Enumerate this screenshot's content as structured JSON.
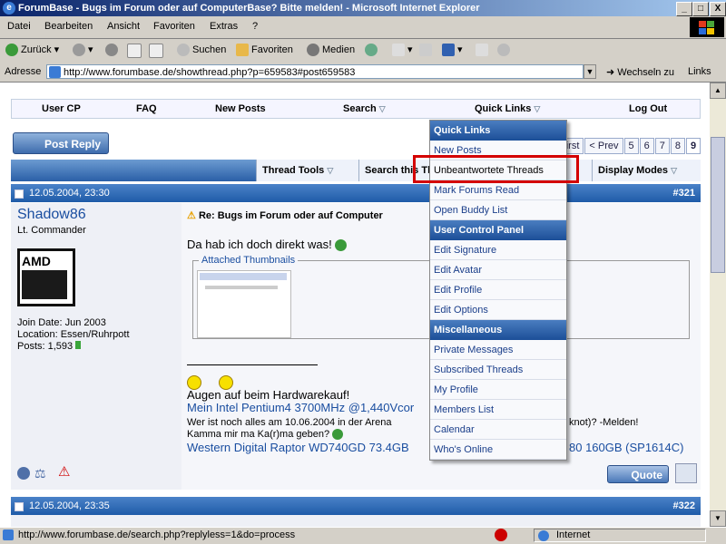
{
  "window": {
    "title": "ForumBase - Bugs im Forum oder auf ComputerBase? Bitte melden! - Microsoft Internet Explorer",
    "min": "_",
    "max": "□",
    "close": "X"
  },
  "menubar": [
    "Datei",
    "Bearbeiten",
    "Ansicht",
    "Favoriten",
    "Extras",
    "?"
  ],
  "toolbar": {
    "back": "Zurück",
    "search": "Suchen",
    "favorites": "Favoriten",
    "media": "Medien"
  },
  "address": {
    "label": "Adresse",
    "url": "http://www.forumbase.de/showthread.php?p=659583#post659583",
    "go": "Wechseln zu",
    "links": "Links"
  },
  "forum_nav": {
    "user_cp": "User CP",
    "faq": "FAQ",
    "new_posts": "New Posts",
    "search": "Search",
    "quick_links": "Quick Links",
    "log_out": "Log Out"
  },
  "post_reply": "Post Reply",
  "pager": [
    "First",
    "< Prev",
    "5",
    "6",
    "7",
    "8",
    "9"
  ],
  "thread_bar": {
    "thread_tools": "Thread Tools",
    "search_thread": "Search this Thread",
    "display_modes": "Display Modes"
  },
  "post1": {
    "date": "12.05.2004, 23:30",
    "number": "#321",
    "username": "Shadow86",
    "user_title": "Lt. Commander",
    "avatar_text": "AMD",
    "join_date": "Join Date: Jun 2003",
    "location": "Location: Essen/Ruhrpott",
    "posts": "Posts: 1,593",
    "subject": "Re: Bugs im Forum oder auf Computer",
    "message": "Da hab ich doch direkt was!",
    "attached": "Attached Thumbnails",
    "sig_line1": "Augen auf beim Hardwarekauf!",
    "sig_line2": "Mein Intel Pentium4 3700MHz @1,440Vcor",
    "sig_line3": "Wer ist noch alles am 10.06.2004 in der Arena",
    "sig_line3b": "knot)? -Melden!",
    "sig_line4": "Kamma mir ma Ka(r)ma geben?",
    "sig_line5": "Western Digital Raptor WD740GD 73.4GB",
    "sig_line5b": "80 160GB (SP1614C)",
    "quote": "Quote"
  },
  "post2": {
    "date": "12.05.2004, 23:35",
    "number": "#322"
  },
  "quick_links_menu": {
    "sections": [
      {
        "header": "Quick Links",
        "items": [
          "New Posts",
          "Unbeantwortete Threads",
          "Mark Forums Read",
          "Open Buddy List"
        ]
      },
      {
        "header": "User Control Panel",
        "items": [
          "Edit Signature",
          "Edit Avatar",
          "Edit Profile",
          "Edit Options"
        ]
      },
      {
        "header": "Miscellaneous",
        "items": [
          "Private Messages",
          "Subscribed Threads",
          "My Profile",
          "Members List",
          "Calendar",
          "Who's Online"
        ]
      }
    ]
  },
  "status": {
    "url": "http://www.forumbase.de/search.php?replyless=1&do=process",
    "zone": "Internet"
  },
  "colors": {
    "accent": "#1f5ba8",
    "highlight": "#d40000",
    "link": "#1a4ea0"
  }
}
